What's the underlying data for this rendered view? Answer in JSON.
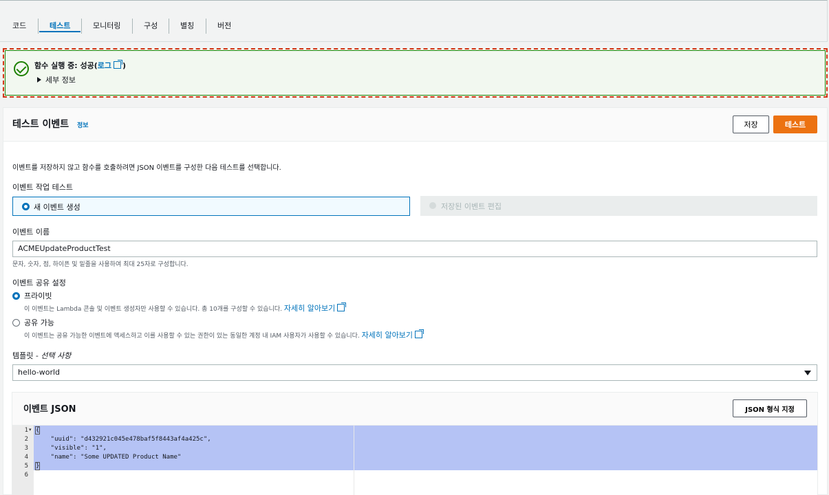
{
  "tabs": [
    {
      "label": "코드"
    },
    {
      "label": "테스트"
    },
    {
      "label": "모니터링"
    },
    {
      "label": "구성"
    },
    {
      "label": "별칭"
    },
    {
      "label": "버전"
    }
  ],
  "banner": {
    "prefix": "함수 실행 중: 성공(",
    "log_link": "로그",
    "suffix": ")",
    "details_label": "세부 정보"
  },
  "test_event": {
    "title": "테스트 이벤트",
    "info_link": "정보",
    "save_label": "저장",
    "test_label": "테스트",
    "description": "이벤트를 저장하지 않고 함수를 호출하려면 JSON 이벤트를 구성한 다음 테스트를 선택합니다.",
    "action_label": "이벤트 작업 테스트",
    "action_new": "새 이벤트 생성",
    "action_edit": "저장된 이벤트 편집",
    "name_label": "이벤트 이름",
    "name_value": "ACMEUpdateProductTest",
    "name_hint": "문자, 숫자, 점, 하이픈 및 밑줄을 사용하여 최대 25자로 구성합니다.",
    "sharing_label": "이벤트 공유 설정",
    "private_label": "프라이빗",
    "private_desc": "이 이벤트는 Lambda 콘솔 및 이벤트 생성자만 사용할 수 있습니다. 총 10개를 구성할 수 있습니다.",
    "learn_more": "자세히 알아보기",
    "shareable_label": "공유 가능",
    "shareable_desc": "이 이벤트는 공유 가능한 이벤트에 액세스하고 이를 사용할 수 있는 권한이 있는 동일한 계정 내 IAM 사용자가 사용할 수 있습니다.",
    "template_label": "템플릿 - ",
    "template_optional": "선택 사항",
    "template_value": "hello-world"
  },
  "event_json": {
    "title": "이벤트 JSON",
    "format_label": "JSON 형식 지정",
    "line_numbers": [
      "1",
      "2",
      "3",
      "4",
      "5",
      "6"
    ],
    "lines": [
      "{",
      "    \"uuid\": \"d432921c045e478baf5f8443af4a425c\",",
      "    \"visible\": \"1\",",
      "    \"name\": \"Some UPDATED Product Name\"",
      "}",
      ""
    ]
  }
}
